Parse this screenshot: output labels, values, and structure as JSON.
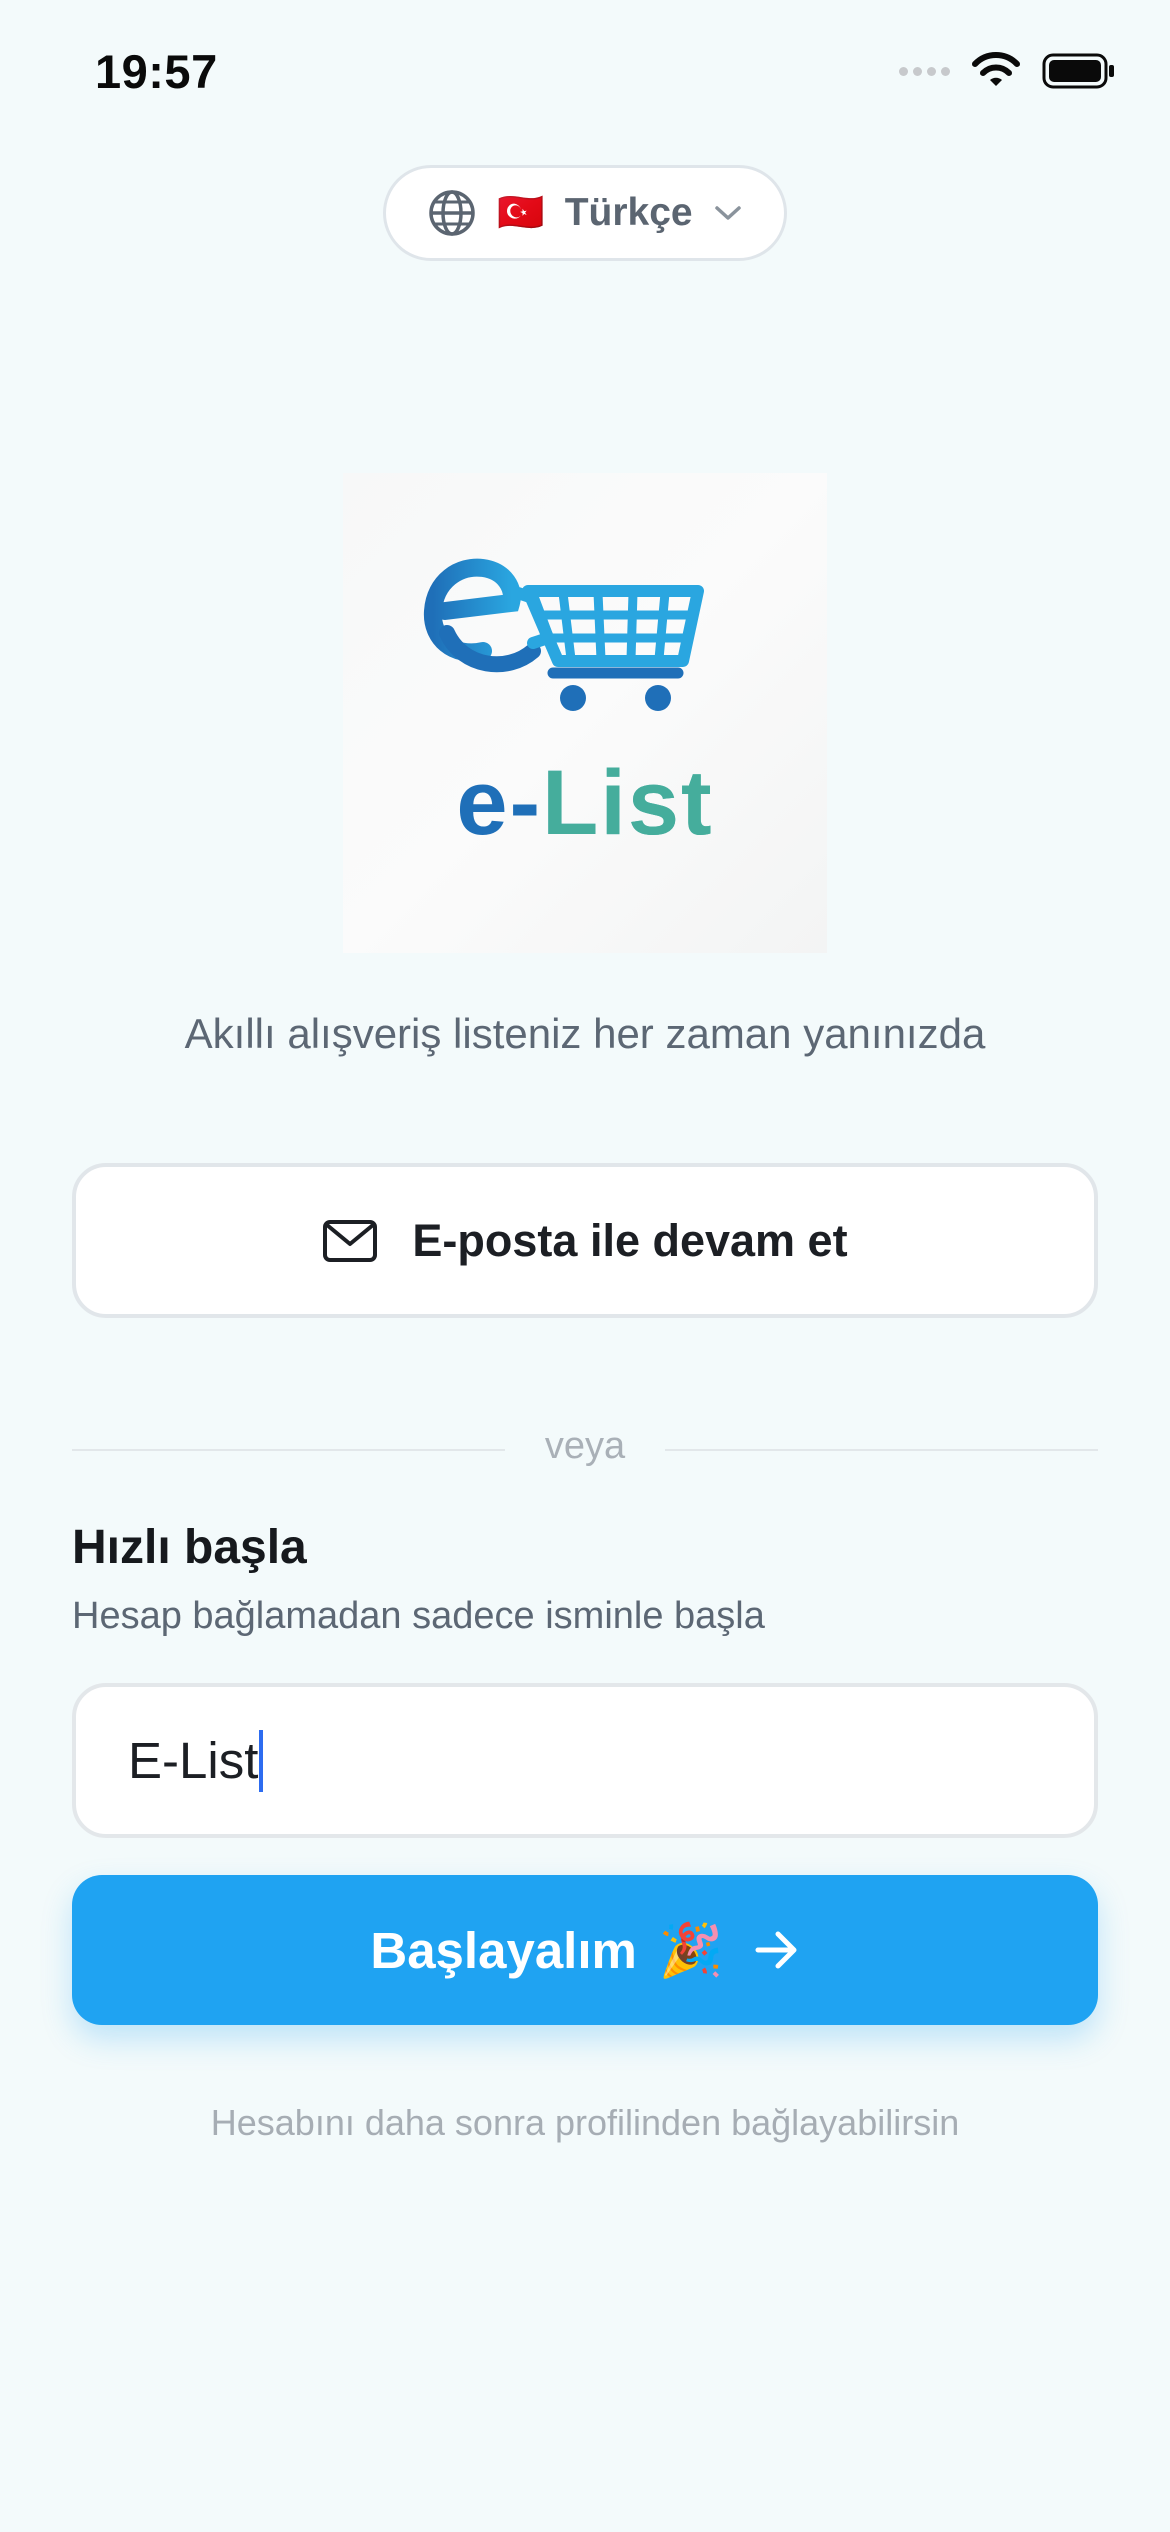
{
  "status_bar": {
    "time": "19:57"
  },
  "language": {
    "flag": "🇹🇷",
    "label": "Türkçe"
  },
  "logo": {
    "prefix": "e-",
    "suffix": "List"
  },
  "tagline": "Akıllı alışveriş listeniz her zaman yanınızda",
  "email_button": {
    "label": "E-posta ile devam et"
  },
  "divider": {
    "text": "veya"
  },
  "quick_start": {
    "title": "Hızlı başla",
    "subtitle": "Hesap bağlamadan sadece isminle başla",
    "name_value": "E-List",
    "button_label": "Başlayalım",
    "button_emoji": "🎉"
  },
  "footnote": "Hesabını daha sonra profilinden bağlayabilirsin",
  "colors": {
    "background": "#f3fafb",
    "primary": "#1fa3f2",
    "logo_blue": "#1f6fb8",
    "logo_green": "#4ab8a0"
  },
  "icons": [
    "signal-icon",
    "wifi-icon",
    "battery-icon",
    "globe-icon",
    "chevron-down-icon",
    "mail-icon",
    "arrow-right-icon",
    "shopping-cart-icon"
  ]
}
